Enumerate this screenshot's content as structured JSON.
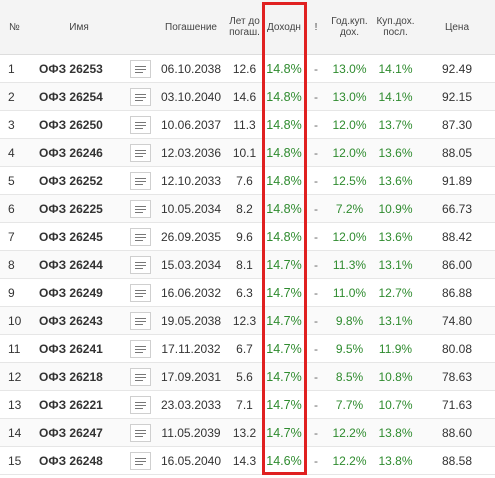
{
  "headers": {
    "num": "№",
    "name": "Имя",
    "maturity": "Погашение",
    "years_l1": "Лет до",
    "years_l2": "погаш.",
    "yield": "Доходн",
    "flag": "!",
    "coupon_l1": "Год.куп.",
    "coupon_l2": "дох.",
    "last_l1": "Куп.дох.",
    "last_l2": "посл.",
    "price": "Цена"
  },
  "accent_color": "#e02020",
  "positive_color": "#2e8b2e",
  "rows": [
    {
      "num": "1",
      "name": "ОФЗ 26253",
      "maturity": "06.10.2038",
      "years": "12.6",
      "yield": "14.8%",
      "flag": "-",
      "coupon": "13.0%",
      "last": "14.1%",
      "price": "92.49"
    },
    {
      "num": "2",
      "name": "ОФЗ 26254",
      "maturity": "03.10.2040",
      "years": "14.6",
      "yield": "14.8%",
      "flag": "-",
      "coupon": "13.0%",
      "last": "14.1%",
      "price": "92.15"
    },
    {
      "num": "3",
      "name": "ОФЗ 26250",
      "maturity": "10.06.2037",
      "years": "11.3",
      "yield": "14.8%",
      "flag": "-",
      "coupon": "12.0%",
      "last": "13.7%",
      "price": "87.30"
    },
    {
      "num": "4",
      "name": "ОФЗ 26246",
      "maturity": "12.03.2036",
      "years": "10.1",
      "yield": "14.8%",
      "flag": "-",
      "coupon": "12.0%",
      "last": "13.6%",
      "price": "88.05"
    },
    {
      "num": "5",
      "name": "ОФЗ 26252",
      "maturity": "12.10.2033",
      "years": "7.6",
      "yield": "14.8%",
      "flag": "-",
      "coupon": "12.5%",
      "last": "13.6%",
      "price": "91.89"
    },
    {
      "num": "6",
      "name": "ОФЗ 26225",
      "maturity": "10.05.2034",
      "years": "8.2",
      "yield": "14.8%",
      "flag": "-",
      "coupon": "7.2%",
      "last": "10.9%",
      "price": "66.73"
    },
    {
      "num": "7",
      "name": "ОФЗ 26245",
      "maturity": "26.09.2035",
      "years": "9.6",
      "yield": "14.8%",
      "flag": "-",
      "coupon": "12.0%",
      "last": "13.6%",
      "price": "88.42"
    },
    {
      "num": "8",
      "name": "ОФЗ 26244",
      "maturity": "15.03.2034",
      "years": "8.1",
      "yield": "14.7%",
      "flag": "-",
      "coupon": "11.3%",
      "last": "13.1%",
      "price": "86.00"
    },
    {
      "num": "9",
      "name": "ОФЗ 26249",
      "maturity": "16.06.2032",
      "years": "6.3",
      "yield": "14.7%",
      "flag": "-",
      "coupon": "11.0%",
      "last": "12.7%",
      "price": "86.88"
    },
    {
      "num": "10",
      "name": "ОФЗ 26243",
      "maturity": "19.05.2038",
      "years": "12.3",
      "yield": "14.7%",
      "flag": "-",
      "coupon": "9.8%",
      "last": "13.1%",
      "price": "74.80"
    },
    {
      "num": "11",
      "name": "ОФЗ 26241",
      "maturity": "17.11.2032",
      "years": "6.7",
      "yield": "14.7%",
      "flag": "-",
      "coupon": "9.5%",
      "last": "11.9%",
      "price": "80.08"
    },
    {
      "num": "12",
      "name": "ОФЗ 26218",
      "maturity": "17.09.2031",
      "years": "5.6",
      "yield": "14.7%",
      "flag": "-",
      "coupon": "8.5%",
      "last": "10.8%",
      "price": "78.63"
    },
    {
      "num": "13",
      "name": "ОФЗ 26221",
      "maturity": "23.03.2033",
      "years": "7.1",
      "yield": "14.7%",
      "flag": "-",
      "coupon": "7.7%",
      "last": "10.7%",
      "price": "71.63"
    },
    {
      "num": "14",
      "name": "ОФЗ 26247",
      "maturity": "11.05.2039",
      "years": "13.2",
      "yield": "14.7%",
      "flag": "-",
      "coupon": "12.2%",
      "last": "13.8%",
      "price": "88.60"
    },
    {
      "num": "15",
      "name": "ОФЗ 26248",
      "maturity": "16.05.2040",
      "years": "14.3",
      "yield": "14.6%",
      "flag": "-",
      "coupon": "12.2%",
      "last": "13.8%",
      "price": "88.58"
    }
  ]
}
